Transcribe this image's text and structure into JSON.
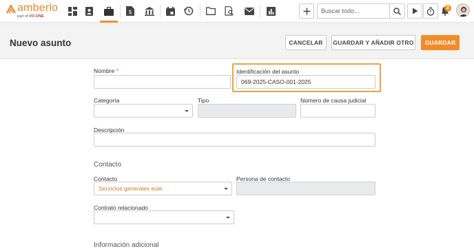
{
  "brand": {
    "name": "amberlo",
    "sub_prefix": "part of",
    "sub_brand": "VO-ONE",
    "accent": "#f28c28"
  },
  "nav": {
    "icons": [
      "dashboard-icon",
      "contacts-icon",
      "matters-icon",
      "invoices-icon",
      "bank-icon",
      "calendar-icon",
      "time-history-icon",
      "folder-icon",
      "search-document-icon",
      "mail-icon",
      "reports-icon"
    ],
    "active": "matters-icon"
  },
  "toolbar": {
    "search_placeholder": "Buscar todo...",
    "notification_count": "2"
  },
  "header": {
    "title": "Nuevo asunto",
    "cancel_label": "CANCELAR",
    "save_add_label": "GUARDAR Y AÑADIR OTRO",
    "save_label": "GUARDAR"
  },
  "form": {
    "name_label": "Nombre",
    "name_required": "*",
    "name_value": "",
    "matter_id_label": "Identificación del asunto",
    "matter_id_value": "069-2025-CASO-001-2025",
    "category_label": "Categoría",
    "category_value": "",
    "type_label": "Tipo",
    "type_value": "",
    "case_number_label": "Número de causa judicial",
    "case_number_value": "",
    "description_label": "Descripción",
    "description_value": "",
    "contact_section": "Contacto",
    "contact_label": "Contacto",
    "contact_value": "Servicios generales eule",
    "contact_person_label": "Persona de contacto",
    "contact_person_value": "",
    "related_contract_label": "Contrato relacionado",
    "related_contract_value": "",
    "additional_section": "Información adicional"
  }
}
